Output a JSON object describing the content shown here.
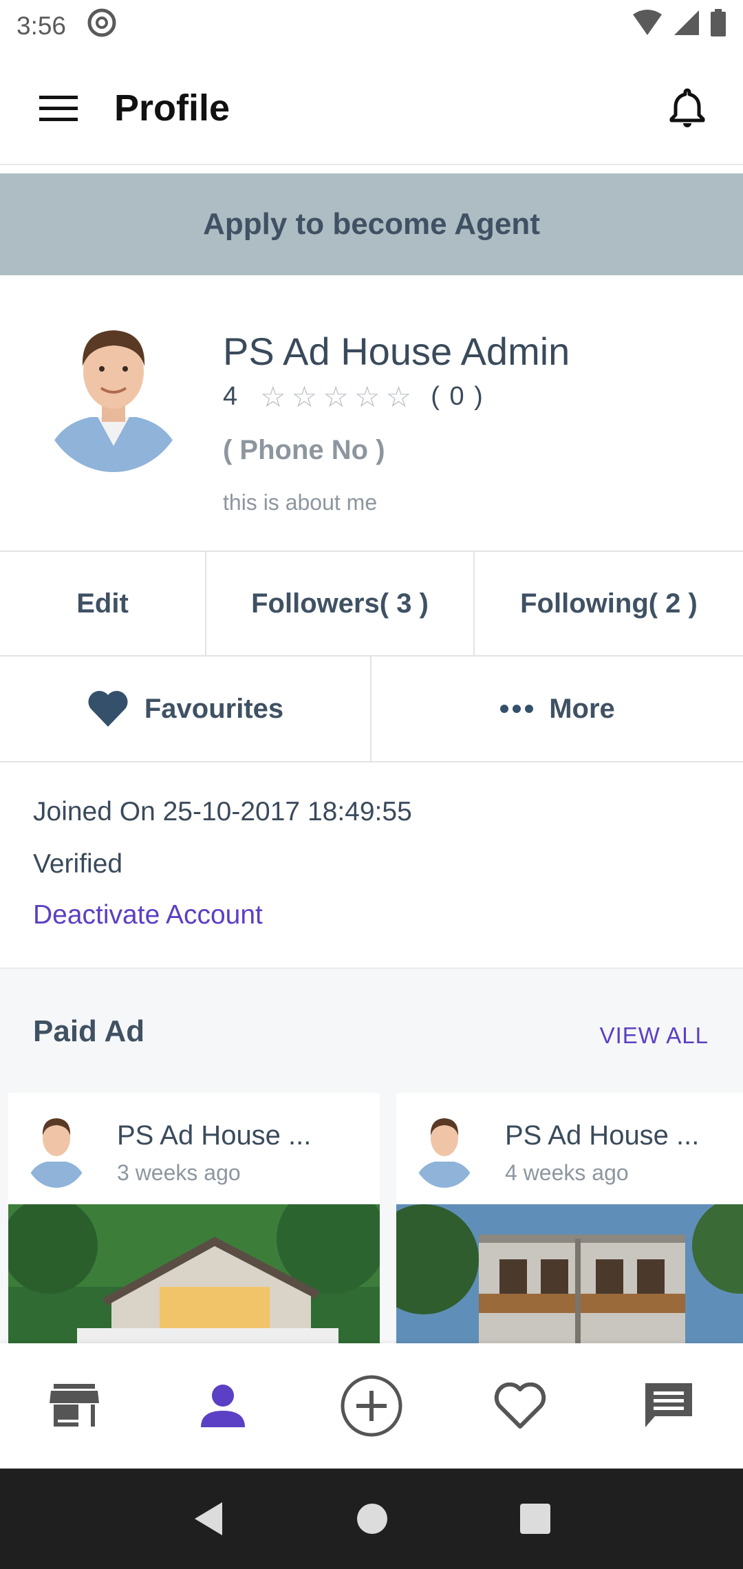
{
  "status": {
    "time": "3:56"
  },
  "app_bar": {
    "title": "Profile"
  },
  "banner": {
    "label": "Apply to become Agent"
  },
  "profile": {
    "name": "PS Ad House Admin",
    "rating_value": "4",
    "rating_stars": 0,
    "rating_count": "( 0 )",
    "phone": "( Phone No )",
    "about": "this is about me"
  },
  "stats": {
    "edit": "Edit",
    "followers": "Followers( 3 )",
    "following": "Following( 2 )"
  },
  "actions": {
    "favourites": "Favourites",
    "more": "More"
  },
  "info": {
    "joined": "Joined On 25-10-2017 18:49:55",
    "verified": "Verified",
    "deactivate": "Deactivate Account"
  },
  "paid_ad": {
    "title": "Paid Ad",
    "view_all": "VIEW ALL",
    "cards": [
      {
        "title": "PS Ad House ...",
        "time": "3 weeks ago"
      },
      {
        "title": "PS Ad House ...",
        "time": "4 weeks ago"
      }
    ]
  },
  "bottom_nav": {
    "items": [
      "store-icon",
      "profile-icon",
      "add-icon",
      "favourite-icon",
      "chat-icon"
    ],
    "active": "profile-icon"
  },
  "colors": {
    "accent": "#5b3fc4",
    "banner": "#aebcc3",
    "text": "#3f5163"
  }
}
